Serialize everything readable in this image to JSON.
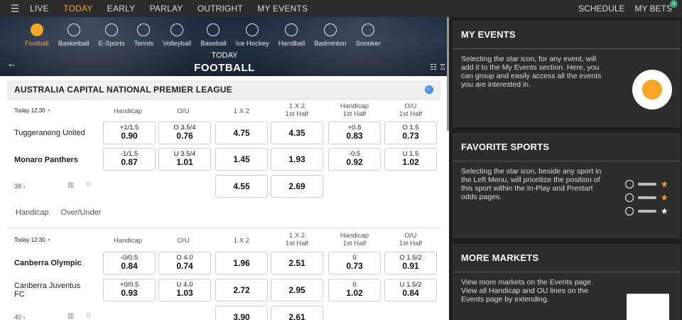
{
  "topbar": {
    "nav": [
      "LIVE",
      "TODAY",
      "EARLY",
      "PARLAY",
      "OUTRIGHT",
      "MY EVENTS"
    ],
    "active": "TODAY",
    "schedule": "SCHEDULE",
    "my_bets": "MY BETS",
    "my_bets_count": "0"
  },
  "sports": [
    {
      "label": "Football",
      "icon": "football-icon"
    },
    {
      "label": "Basketball",
      "icon": "basketball-icon"
    },
    {
      "label": "E-Sports",
      "icon": "esports-icon"
    },
    {
      "label": "Tennis",
      "icon": "tennis-icon"
    },
    {
      "label": "Volleyball",
      "icon": "volleyball-icon"
    },
    {
      "label": "Baseball",
      "icon": "baseball-icon"
    },
    {
      "label": "Ice Hockey",
      "icon": "ice-hockey-icon"
    },
    {
      "label": "Handball",
      "icon": "handball-icon"
    },
    {
      "label": "Badminton",
      "icon": "badminton-icon"
    },
    {
      "label": "Snooker",
      "icon": "snooker-icon"
    }
  ],
  "hero": {
    "day": "TODAY",
    "title": "FOOTBALL"
  },
  "league": "AUSTRALIA CAPITAL NATIONAL PREMIER LEAGUE",
  "headers": [
    "Handicap",
    "O/U",
    "1 X 2",
    "1 X 2",
    "1st Half",
    "Handicap",
    "1st Half",
    "O/U",
    "1st Half"
  ],
  "events": [
    {
      "time": "Today 12:30",
      "teams": [
        "Tuggeranong United",
        "Monaro Panthers"
      ],
      "team_bold": [
        false,
        true
      ],
      "rows": [
        [
          [
            "+1/1.5",
            "0.90"
          ],
          [
            "O 3.5/4",
            "0.76"
          ],
          [
            "",
            "4.75"
          ],
          [
            "",
            "4.35"
          ],
          [
            "+0.5",
            "0.83"
          ],
          [
            "O 1.5",
            "0.73"
          ]
        ],
        [
          [
            "-1/1.5",
            "0.87"
          ],
          [
            "U 3.5/4",
            "1.01"
          ],
          [
            "",
            "1.45"
          ],
          [
            "",
            "1.93"
          ],
          [
            "-0.5",
            "0.92"
          ],
          [
            "U 1.5",
            "1.02"
          ]
        ],
        [
          null,
          null,
          [
            "",
            "4.55"
          ],
          [
            "",
            "2.69"
          ],
          null,
          null
        ]
      ],
      "more": "38"
    },
    {
      "time": "Today 12:30",
      "teams": [
        "Canberra Olympic",
        "Canberra Juventus FC"
      ],
      "team_bold": [
        true,
        false
      ],
      "rows": [
        [
          [
            "-0/0.5",
            "0.84"
          ],
          [
            "O 4.0",
            "0.74"
          ],
          [
            "",
            "1.96"
          ],
          [
            "",
            "2.51"
          ],
          [
            "0",
            "0.73"
          ],
          [
            "O 1.5/2",
            "0.91"
          ]
        ],
        [
          [
            "+0/0.5",
            "0.93"
          ],
          [
            "U 4.0",
            "1.03"
          ],
          [
            "",
            "2.72"
          ],
          [
            "",
            "2.95"
          ],
          [
            "0",
            "1.02"
          ],
          [
            "U 1.5/2",
            "0.84"
          ]
        ],
        [
          null,
          null,
          [
            "",
            "3.90"
          ],
          [
            "",
            "2.61"
          ],
          null,
          null
        ]
      ],
      "more": "40"
    }
  ],
  "market_tabs": [
    "Handicap",
    "Over/Under"
  ],
  "side": {
    "my_events": {
      "title": "MY EVENTS",
      "text": "Selecting the star icon, for any event, will add it to the My Events section. Here, you can group and easily access all the events you are interested in."
    },
    "favorite": {
      "title": "FAVORITE SPORTS",
      "text": "Selecting the star icon, beside any sport in the Left Menu, will prioritize the position of this sport within the In-Play and Prestart odds pages."
    },
    "more": {
      "title": "MORE MARKETS",
      "text": "View more markets on the Events page. View all Handicap and OU lines on the Events page by extending."
    }
  },
  "colors": {
    "accent": "#f5a623",
    "dark": "#2b2b2b"
  }
}
